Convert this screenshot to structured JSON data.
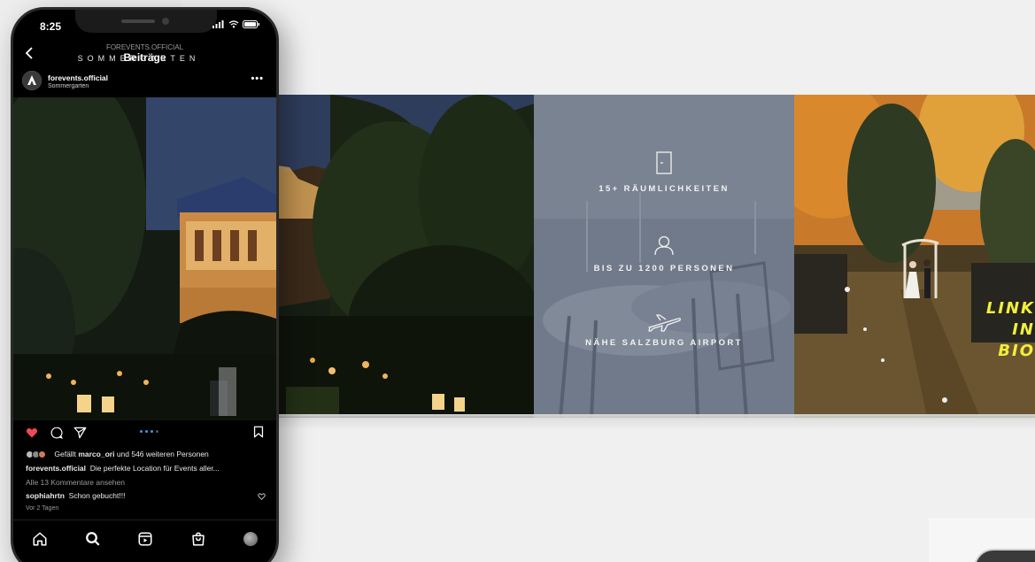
{
  "status_bar": {
    "time": "8:25"
  },
  "header": {
    "owner": "FOREVENTS.OFFICIAL",
    "title": "Beiträge"
  },
  "post": {
    "account": "forevents.official",
    "location": "Sommergarten",
    "image_caption": "SOMMERGARTEN",
    "likes_prefix": "Gefällt",
    "likes_user": "marco_ori",
    "likes_suffix": "und 546 weiteren  Personen",
    "caption_user": "forevents.official",
    "caption_text": "Die perfekte Location für Events aller...",
    "view_comments": "Alle 13 Kommentare ansehen",
    "comment_user": "sophiahrtn",
    "comment_text": "Schon gebucht!!!",
    "posted": "Vor 2 Tagen",
    "liked": true,
    "carousel_total": 4,
    "carousel_index": 1
  },
  "carousel": {
    "features": [
      {
        "icon": "door-icon",
        "label": "15+ RÄUMLICHKEITEN"
      },
      {
        "icon": "person-icon",
        "label": "BIS ZU 1200 PERSONEN"
      },
      {
        "icon": "airplane-icon",
        "label": "NÄHE SALZBURG AIRPORT"
      }
    ],
    "link_bio_lines": [
      "LINK",
      "IN",
      "BIO"
    ]
  },
  "colors": {
    "like_red": "#ed4956",
    "accent_blue": "#3897f0",
    "link_bio_yellow": "#f1ef3a"
  }
}
